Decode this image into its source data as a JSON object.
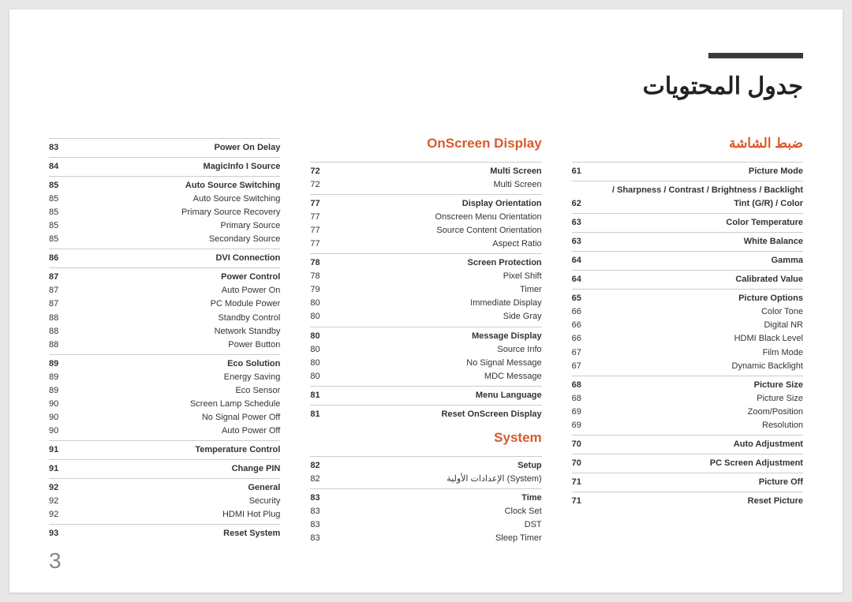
{
  "page_number": "3",
  "main_title": "جدول المحتويات",
  "columns": [
    {
      "sections": [
        {
          "title": "",
          "groups": [
            {
              "rows": [
                {
                  "pg": "83",
                  "lbl": "Power On Delay",
                  "bold": true
                }
              ]
            },
            {
              "rows": [
                {
                  "pg": "84",
                  "lbl": "MagicInfo I Source",
                  "bold": true
                }
              ]
            },
            {
              "rows": [
                {
                  "pg": "85",
                  "lbl": "Auto Source Switching",
                  "bold": true
                },
                {
                  "pg": "85",
                  "lbl": "Auto Source Switching"
                },
                {
                  "pg": "85",
                  "lbl": "Primary Source Recovery"
                },
                {
                  "pg": "85",
                  "lbl": "Primary Source"
                },
                {
                  "pg": "85",
                  "lbl": "Secondary Source"
                }
              ]
            },
            {
              "rows": [
                {
                  "pg": "86",
                  "lbl": "DVI Connection",
                  "bold": true
                }
              ]
            },
            {
              "rows": [
                {
                  "pg": "87",
                  "lbl": "Power Control",
                  "bold": true
                },
                {
                  "pg": "87",
                  "lbl": "Auto Power On"
                },
                {
                  "pg": "87",
                  "lbl": "PC Module Power"
                },
                {
                  "pg": "88",
                  "lbl": "Standby Control"
                },
                {
                  "pg": "88",
                  "lbl": "Network Standby"
                },
                {
                  "pg": "88",
                  "lbl": "Power Button"
                }
              ]
            },
            {
              "rows": [
                {
                  "pg": "89",
                  "lbl": "Eco Solution",
                  "bold": true
                },
                {
                  "pg": "89",
                  "lbl": "Energy Saving"
                },
                {
                  "pg": "89",
                  "lbl": "Eco Sensor"
                },
                {
                  "pg": "90",
                  "lbl": "Screen Lamp Schedule"
                },
                {
                  "pg": "90",
                  "lbl": "No Signal Power Off"
                },
                {
                  "pg": "90",
                  "lbl": "Auto Power Off"
                }
              ]
            },
            {
              "rows": [
                {
                  "pg": "91",
                  "lbl": "Temperature Control",
                  "bold": true
                }
              ]
            },
            {
              "rows": [
                {
                  "pg": "91",
                  "lbl": "Change PIN",
                  "bold": true
                }
              ]
            },
            {
              "rows": [
                {
                  "pg": "92",
                  "lbl": "General",
                  "bold": true
                },
                {
                  "pg": "92",
                  "lbl": "Security"
                },
                {
                  "pg": "92",
                  "lbl": "HDMI Hot Plug"
                }
              ]
            },
            {
              "rows": [
                {
                  "pg": "93",
                  "lbl": "Reset System",
                  "bold": true
                }
              ]
            }
          ]
        }
      ]
    },
    {
      "sections": [
        {
          "title": "OnScreen Display",
          "title_ltr": true,
          "groups": [
            {
              "rows": [
                {
                  "pg": "72",
                  "lbl": "Multi Screen",
                  "bold": true
                },
                {
                  "pg": "72",
                  "lbl": "Multi Screen"
                }
              ]
            },
            {
              "rows": [
                {
                  "pg": "77",
                  "lbl": "Display Orientation",
                  "bold": true
                },
                {
                  "pg": "77",
                  "lbl": "Onscreen Menu Orientation"
                },
                {
                  "pg": "77",
                  "lbl": "Source Content Orientation"
                },
                {
                  "pg": "77",
                  "lbl": "Aspect Ratio"
                }
              ]
            },
            {
              "rows": [
                {
                  "pg": "78",
                  "lbl": "Screen Protection",
                  "bold": true
                },
                {
                  "pg": "78",
                  "lbl": "Pixel Shift"
                },
                {
                  "pg": "79",
                  "lbl": "Timer"
                },
                {
                  "pg": "80",
                  "lbl": "Immediate Display"
                },
                {
                  "pg": "80",
                  "lbl": "Side Gray"
                }
              ]
            },
            {
              "rows": [
                {
                  "pg": "80",
                  "lbl": "Message Display",
                  "bold": true
                },
                {
                  "pg": "80",
                  "lbl": "Source Info"
                },
                {
                  "pg": "80",
                  "lbl": "No Signal Message"
                },
                {
                  "pg": "80",
                  "lbl": "MDC Message"
                }
              ]
            },
            {
              "rows": [
                {
                  "pg": "81",
                  "lbl": "Menu Language",
                  "bold": true
                }
              ]
            },
            {
              "rows": [
                {
                  "pg": "81",
                  "lbl": "Reset OnScreen Display",
                  "bold": true
                }
              ]
            }
          ]
        },
        {
          "title": "System",
          "title_ltr": true,
          "spacer_before": true,
          "groups": [
            {
              "rows": [
                {
                  "pg": "82",
                  "lbl": "Setup",
                  "bold": true
                },
                {
                  "pg": "82",
                  "lbl": "الإعدادات الأولية (System)"
                }
              ]
            },
            {
              "rows": [
                {
                  "pg": "83",
                  "lbl": "Time",
                  "bold": true
                },
                {
                  "pg": "83",
                  "lbl": "Clock Set"
                },
                {
                  "pg": "83",
                  "lbl": "DST"
                },
                {
                  "pg": "83",
                  "lbl": "Sleep Timer"
                }
              ]
            }
          ]
        }
      ]
    },
    {
      "sections": [
        {
          "title": "ضبط الشاشة",
          "groups": [
            {
              "rows": [
                {
                  "pg": "61",
                  "lbl": "Picture Mode",
                  "bold": true
                }
              ]
            },
            {
              "rows": [
                {
                  "pg": "",
                  "lbl": "/ Sharpness / Contrast / Brightness / Backlight",
                  "bold": true
                },
                {
                  "pg": "62",
                  "lbl": "Tint (G/R) / Color",
                  "bold": true
                }
              ]
            },
            {
              "rows": [
                {
                  "pg": "63",
                  "lbl": "Color Temperature",
                  "bold": true
                }
              ]
            },
            {
              "rows": [
                {
                  "pg": "63",
                  "lbl": "White Balance",
                  "bold": true
                }
              ]
            },
            {
              "rows": [
                {
                  "pg": "64",
                  "lbl": "Gamma",
                  "bold": true
                }
              ]
            },
            {
              "rows": [
                {
                  "pg": "64",
                  "lbl": "Calibrated Value",
                  "bold": true
                }
              ]
            },
            {
              "rows": [
                {
                  "pg": "65",
                  "lbl": "Picture Options",
                  "bold": true
                },
                {
                  "pg": "66",
                  "lbl": "Color Tone"
                },
                {
                  "pg": "66",
                  "lbl": "Digital NR"
                },
                {
                  "pg": "66",
                  "lbl": "HDMI Black Level"
                },
                {
                  "pg": "67",
                  "lbl": "Film Mode"
                },
                {
                  "pg": "67",
                  "lbl": "Dynamic Backlight"
                }
              ]
            },
            {
              "rows": [
                {
                  "pg": "68",
                  "lbl": "Picture Size",
                  "bold": true
                },
                {
                  "pg": "68",
                  "lbl": "Picture Size"
                },
                {
                  "pg": "69",
                  "lbl": "Zoom/Position"
                },
                {
                  "pg": "69",
                  "lbl": "Resolution"
                }
              ]
            },
            {
              "rows": [
                {
                  "pg": "70",
                  "lbl": "Auto Adjustment",
                  "bold": true
                }
              ]
            },
            {
              "rows": [
                {
                  "pg": "70",
                  "lbl": "PC Screen Adjustment",
                  "bold": true
                }
              ]
            },
            {
              "rows": [
                {
                  "pg": "71",
                  "lbl": "Picture Off",
                  "bold": true
                }
              ]
            },
            {
              "rows": [
                {
                  "pg": "71",
                  "lbl": "Reset Picture",
                  "bold": true
                }
              ]
            }
          ]
        }
      ]
    }
  ]
}
